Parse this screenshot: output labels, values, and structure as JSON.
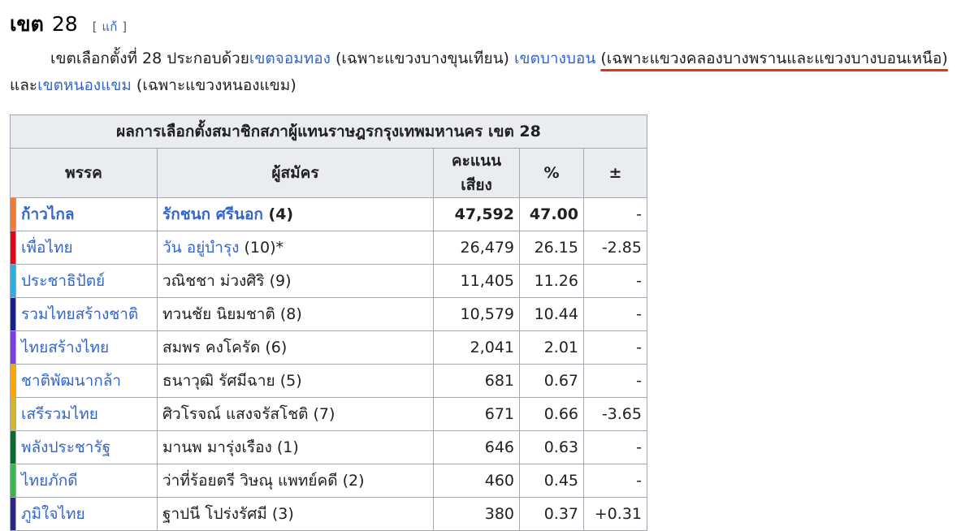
{
  "section": {
    "title": "เขต",
    "number": "28",
    "edit_open": "[",
    "edit_label": "แก้",
    "edit_close": "]"
  },
  "intro": {
    "t1": "เขตเลือกตั้งที่ 28 ประกอบด้วย",
    "l1": "เขตจอมทอง",
    "t2": " (เฉพาะแขวงบางขุนเทียน) ",
    "l2": "เขตบางบอน",
    "t3": "(เฉพาะแขวงคลองบางพรานและแขวงบางบอนเหนือ)",
    "t4": "และ",
    "l3": "เขตหนองแขม",
    "t5": " (เฉพาะแขวงหนองแขม)"
  },
  "table": {
    "caption": "ผลการเลือกตั้งสมาชิกสภาผู้แทนราษฎรกรุงเทพมหานคร เขต 28",
    "headers": {
      "party": "พรรค",
      "candidate": "ผู้สมัคร",
      "votes": "คะแนนเสียง",
      "percent": "%",
      "change": "±"
    },
    "rows": [
      {
        "color": "#f47933",
        "party": "ก้าวไกล",
        "candidate": "รักชนก ศรีนอก",
        "number": "(4)",
        "linked": true,
        "votes": "47,592",
        "percent": "47.00",
        "change": "-",
        "winner": true
      },
      {
        "color": "#e30613",
        "party": "เพื่อไทย",
        "candidate": "วัน อยู่บำรุง",
        "number": "(10)*",
        "linked": true,
        "votes": "26,479",
        "percent": "26.15",
        "change": "-2.85",
        "winner": false
      },
      {
        "color": "#2eaee6",
        "party": "ประชาธิปัตย์",
        "candidate": "วณิชชา ม่วงศิริ",
        "number": "(9)",
        "linked": false,
        "votes": "11,405",
        "percent": "11.26",
        "change": "-",
        "winner": false
      },
      {
        "color": "#1c1f8a",
        "party": "รวมไทยสร้างชาติ",
        "candidate": "ทวนชัย นิยมชาติ",
        "number": "(8)",
        "linked": false,
        "votes": "10,579",
        "percent": "10.44",
        "change": "-",
        "winner": false
      },
      {
        "color": "#7d3be6",
        "party": "ไทยสร้างไทย",
        "candidate": "สมพร คงโครัด",
        "number": "(6)",
        "linked": false,
        "votes": "2,041",
        "percent": "2.01",
        "change": "-",
        "winner": false
      },
      {
        "color": "#ffa500",
        "party": "ชาติพัฒนากล้า",
        "candidate": "ธนาวุฒิ รัศมีฉาย",
        "number": "(5)",
        "linked": false,
        "votes": "681",
        "percent": "0.67",
        "change": "-",
        "winner": false
      },
      {
        "color": "#d4b52b",
        "party": "เสรีรวมไทย",
        "candidate": "ศิวโรจณ์ แสงจรัสโชติ",
        "number": "(7)",
        "linked": false,
        "votes": "671",
        "percent": "0.66",
        "change": "-3.65",
        "winner": false
      },
      {
        "color": "#0a6b31",
        "party": "พลังประชารัฐ",
        "candidate": "มานพ มารุ่งเรือง",
        "number": "(1)",
        "linked": false,
        "votes": "646",
        "percent": "0.63",
        "change": "-",
        "winner": false
      },
      {
        "color": "#3cb84a",
        "party": "ไทยภักดี",
        "candidate": "ว่าที่ร้อยตรี วิษณุ แพทย์คดี",
        "number": "(2)",
        "linked": false,
        "votes": "460",
        "percent": "0.45",
        "change": "-",
        "winner": false
      },
      {
        "color": "#2c2587",
        "party": "ภูมิใจไทย",
        "candidate": "ฐาปนี โปร่งรัศมี",
        "number": "(3)",
        "linked": false,
        "votes": "380",
        "percent": "0.37",
        "change": "+0.31",
        "winner": false
      }
    ]
  }
}
